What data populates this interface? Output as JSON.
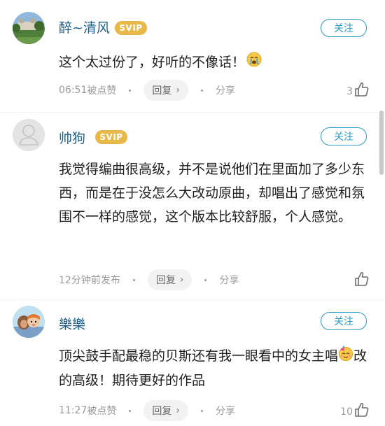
{
  "comments": [
    {
      "username": "醉~清风",
      "badge": "SVIP",
      "follow_label": "关注",
      "text_parts": [
        "这个太过份了，好听的不像话！"
      ],
      "time": "06:51",
      "liked_label": "被点赞",
      "reply_label": "回复",
      "share_label": "分享",
      "like_count": "3",
      "avatar": "landscape-photo"
    },
    {
      "username": "帅狗",
      "badge": "SVIP",
      "follow_label": "关注",
      "text_parts": [
        "我觉得编曲很高级，并不是说他们在里面加了多少东西，而是在于没怎么大改动原曲，却唱出了感觉和氛围不一样的感觉，这个版本比较舒服，个人感觉。"
      ],
      "time": "12分钟前发布",
      "reply_label": "回复",
      "share_label": "分享",
      "like_count": "",
      "avatar": "default-person"
    },
    {
      "username": "樂樂",
      "follow_label": "关注",
      "text_parts": [
        "顶尖鼓手配最稳的贝斯还有我一眼看中的女主唱",
        "改的高级！期待更好的作品"
      ],
      "time": "11:27",
      "liked_label": "被点赞",
      "reply_label": "回复",
      "share_label": "分享",
      "like_count": "10",
      "avatar": "cartoon-character"
    }
  ],
  "colors": {
    "username": "#1f5f8a",
    "svip_badge": "#e8b84a",
    "follow_border": "#2e9bc2",
    "meta_text": "#9a9a9a"
  }
}
